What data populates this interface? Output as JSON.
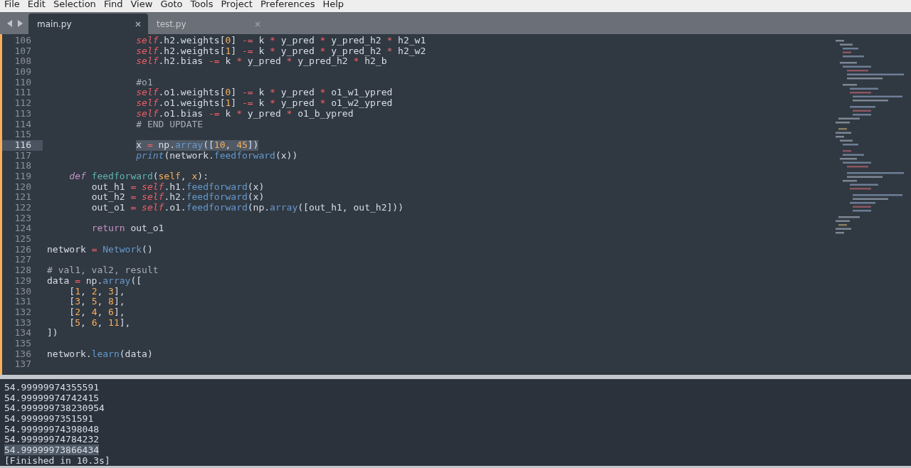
{
  "menu": [
    "File",
    "Edit",
    "Selection",
    "Find",
    "View",
    "Goto",
    "Tools",
    "Project",
    "Preferences",
    "Help"
  ],
  "tabs": [
    {
      "label": "main.py",
      "selected": true
    },
    {
      "label": "test.py",
      "selected": false
    }
  ],
  "editor": {
    "lines": [
      {
        "number": "106",
        "current": false,
        "selected": false,
        "tokens": [
          {
            "text": "                self",
            "kind": "self"
          },
          {
            "text": ".h2.weights[",
            "kind": "plain"
          },
          {
            "text": "0",
            "kind": "num"
          },
          {
            "text": "] ",
            "kind": "plain"
          },
          {
            "text": "-=",
            "kind": "op"
          },
          {
            "text": " k ",
            "kind": "plain"
          },
          {
            "text": "*",
            "kind": "op"
          },
          {
            "text": " y_pred ",
            "kind": "plain"
          },
          {
            "text": "*",
            "kind": "op"
          },
          {
            "text": " y_pred_h2 ",
            "kind": "plain"
          },
          {
            "text": "*",
            "kind": "op"
          },
          {
            "text": " h2_w1",
            "kind": "plain"
          }
        ]
      },
      {
        "number": "107",
        "current": false,
        "selected": false,
        "tokens": [
          {
            "text": "                self",
            "kind": "self"
          },
          {
            "text": ".h2.weights[",
            "kind": "plain"
          },
          {
            "text": "1",
            "kind": "num"
          },
          {
            "text": "] ",
            "kind": "plain"
          },
          {
            "text": "-=",
            "kind": "op"
          },
          {
            "text": " k ",
            "kind": "plain"
          },
          {
            "text": "*",
            "kind": "op"
          },
          {
            "text": " y_pred ",
            "kind": "plain"
          },
          {
            "text": "*",
            "kind": "op"
          },
          {
            "text": " y_pred_h2 ",
            "kind": "plain"
          },
          {
            "text": "*",
            "kind": "op"
          },
          {
            "text": " h2_w2",
            "kind": "plain"
          }
        ]
      },
      {
        "number": "108",
        "current": false,
        "selected": false,
        "tokens": [
          {
            "text": "                self",
            "kind": "self"
          },
          {
            "text": ".h2.bias ",
            "kind": "plain"
          },
          {
            "text": "-=",
            "kind": "op"
          },
          {
            "text": " k ",
            "kind": "plain"
          },
          {
            "text": "*",
            "kind": "op"
          },
          {
            "text": " y_pred ",
            "kind": "plain"
          },
          {
            "text": "*",
            "kind": "op"
          },
          {
            "text": " y_pred_h2 ",
            "kind": "plain"
          },
          {
            "text": "*",
            "kind": "op"
          },
          {
            "text": " h2_b",
            "kind": "plain"
          }
        ]
      },
      {
        "number": "109",
        "current": false,
        "selected": false
      },
      {
        "number": "110",
        "current": false,
        "selected": false,
        "tokens": [
          {
            "text": "                #o1",
            "kind": "comment"
          }
        ]
      },
      {
        "number": "111",
        "current": false,
        "selected": false,
        "tokens": [
          {
            "text": "                self",
            "kind": "self"
          },
          {
            "text": ".o1.weights[",
            "kind": "plain"
          },
          {
            "text": "0",
            "kind": "num"
          },
          {
            "text": "] ",
            "kind": "plain"
          },
          {
            "text": "-=",
            "kind": "op"
          },
          {
            "text": " k ",
            "kind": "plain"
          },
          {
            "text": "*",
            "kind": "op"
          },
          {
            "text": " y_pred ",
            "kind": "plain"
          },
          {
            "text": "*",
            "kind": "op"
          },
          {
            "text": " o1_w1_ypred",
            "kind": "plain"
          }
        ]
      },
      {
        "number": "112",
        "current": false,
        "selected": false,
        "tokens": [
          {
            "text": "                self",
            "kind": "self"
          },
          {
            "text": ".o1.weights[",
            "kind": "plain"
          },
          {
            "text": "1",
            "kind": "num"
          },
          {
            "text": "] ",
            "kind": "plain"
          },
          {
            "text": "-=",
            "kind": "op"
          },
          {
            "text": " k ",
            "kind": "plain"
          },
          {
            "text": "*",
            "kind": "op"
          },
          {
            "text": " y_pred ",
            "kind": "plain"
          },
          {
            "text": "*",
            "kind": "op"
          },
          {
            "text": " o1_w2_ypred",
            "kind": "plain"
          }
        ]
      },
      {
        "number": "113",
        "current": false,
        "selected": false,
        "tokens": [
          {
            "text": "                self",
            "kind": "self"
          },
          {
            "text": ".o1.bias ",
            "kind": "plain"
          },
          {
            "text": "-=",
            "kind": "op"
          },
          {
            "text": " k ",
            "kind": "plain"
          },
          {
            "text": "*",
            "kind": "op"
          },
          {
            "text": " y_pred ",
            "kind": "plain"
          },
          {
            "text": "*",
            "kind": "op"
          },
          {
            "text": " o1_b_ypred",
            "kind": "plain"
          }
        ]
      },
      {
        "number": "114",
        "current": false,
        "selected": false,
        "tokens": [
          {
            "text": "                # END UPDATE",
            "kind": "comment"
          }
        ]
      },
      {
        "number": "115",
        "current": false,
        "selected": false
      },
      {
        "number": "116",
        "current": true,
        "selected": true,
        "tokens": [
          {
            "text": "                x ",
            "kind": "plain"
          },
          {
            "text": "=",
            "kind": "op"
          },
          {
            "text": " np.",
            "kind": "plain"
          },
          {
            "text": "array",
            "kind": "func"
          },
          {
            "text": "([",
            "kind": "plain"
          },
          {
            "text": "10",
            "kind": "num"
          },
          {
            "text": ", ",
            "kind": "plain"
          },
          {
            "text": "45",
            "kind": "num"
          },
          {
            "text": "])",
            "kind": "plain"
          }
        ]
      },
      {
        "number": "117",
        "current": false,
        "selected": false,
        "tokens": [
          {
            "text": "                print",
            "kind": "builtin"
          },
          {
            "text": "(network.",
            "kind": "plain"
          },
          {
            "text": "feedforward",
            "kind": "func"
          },
          {
            "text": "(x))",
            "kind": "plain"
          }
        ]
      },
      {
        "number": "118",
        "current": false,
        "selected": false
      },
      {
        "number": "119",
        "current": false,
        "selected": false,
        "tokens": [
          {
            "text": "    def ",
            "kind": "defkw"
          },
          {
            "text": "feedforward",
            "kind": "defname"
          },
          {
            "text": "(",
            "kind": "plain"
          },
          {
            "text": "self",
            "kind": "param"
          },
          {
            "text": ", ",
            "kind": "plain"
          },
          {
            "text": "x",
            "kind": "param"
          },
          {
            "text": "):",
            "kind": "plain"
          }
        ]
      },
      {
        "number": "120",
        "current": false,
        "selected": false,
        "tokens": [
          {
            "text": "        out_h1 ",
            "kind": "plain"
          },
          {
            "text": "= ",
            "kind": "op"
          },
          {
            "text": "self",
            "kind": "self"
          },
          {
            "text": ".h1.",
            "kind": "plain"
          },
          {
            "text": "feedforward",
            "kind": "func"
          },
          {
            "text": "(x)",
            "kind": "plain"
          }
        ]
      },
      {
        "number": "121",
        "current": false,
        "selected": false,
        "tokens": [
          {
            "text": "        out_h2 ",
            "kind": "plain"
          },
          {
            "text": "= ",
            "kind": "op"
          },
          {
            "text": "self",
            "kind": "self"
          },
          {
            "text": ".h2.",
            "kind": "plain"
          },
          {
            "text": "feedforward",
            "kind": "func"
          },
          {
            "text": "(x)",
            "kind": "plain"
          }
        ]
      },
      {
        "number": "122",
        "current": false,
        "selected": false,
        "tokens": [
          {
            "text": "        out_o1 ",
            "kind": "plain"
          },
          {
            "text": "= ",
            "kind": "op"
          },
          {
            "text": "self",
            "kind": "self"
          },
          {
            "text": ".o1.",
            "kind": "plain"
          },
          {
            "text": "feedforward",
            "kind": "func"
          },
          {
            "text": "(np.",
            "kind": "plain"
          },
          {
            "text": "array",
            "kind": "func"
          },
          {
            "text": "([out_h1, out_h2]))",
            "kind": "plain"
          }
        ]
      },
      {
        "number": "123",
        "current": false,
        "selected": false
      },
      {
        "number": "124",
        "current": false,
        "selected": false,
        "tokens": [
          {
            "text": "        return",
            "kind": "keyword"
          },
          {
            "text": " out_o1",
            "kind": "plain"
          }
        ]
      },
      {
        "number": "125",
        "current": false,
        "selected": false
      },
      {
        "number": "126",
        "current": false,
        "selected": false,
        "tokens": [
          {
            "text": "network ",
            "kind": "plain"
          },
          {
            "text": "= ",
            "kind": "op"
          },
          {
            "text": "Network",
            "kind": "func"
          },
          {
            "text": "()",
            "kind": "plain"
          }
        ]
      },
      {
        "number": "127",
        "current": false,
        "selected": false
      },
      {
        "number": "128",
        "current": false,
        "selected": false,
        "tokens": [
          {
            "text": "# val1, val2, result",
            "kind": "comment"
          }
        ]
      },
      {
        "number": "129",
        "current": false,
        "selected": false,
        "tokens": [
          {
            "text": "data ",
            "kind": "plain"
          },
          {
            "text": "=",
            "kind": "op"
          },
          {
            "text": " np.",
            "kind": "plain"
          },
          {
            "text": "array",
            "kind": "func"
          },
          {
            "text": "([",
            "kind": "plain"
          }
        ]
      },
      {
        "number": "130",
        "current": false,
        "selected": false,
        "tokens": [
          {
            "text": "    [",
            "kind": "plain"
          },
          {
            "text": "1",
            "kind": "num"
          },
          {
            "text": ", ",
            "kind": "plain"
          },
          {
            "text": "2",
            "kind": "num"
          },
          {
            "text": ", ",
            "kind": "plain"
          },
          {
            "text": "3",
            "kind": "num"
          },
          {
            "text": "],",
            "kind": "plain"
          }
        ]
      },
      {
        "number": "131",
        "current": false,
        "selected": false,
        "tokens": [
          {
            "text": "    [",
            "kind": "plain"
          },
          {
            "text": "3",
            "kind": "num"
          },
          {
            "text": ", ",
            "kind": "plain"
          },
          {
            "text": "5",
            "kind": "num"
          },
          {
            "text": ", ",
            "kind": "plain"
          },
          {
            "text": "8",
            "kind": "num"
          },
          {
            "text": "],",
            "kind": "plain"
          }
        ]
      },
      {
        "number": "132",
        "current": false,
        "selected": false,
        "tokens": [
          {
            "text": "    [",
            "kind": "plain"
          },
          {
            "text": "2",
            "kind": "num"
          },
          {
            "text": ", ",
            "kind": "plain"
          },
          {
            "text": "4",
            "kind": "num"
          },
          {
            "text": ", ",
            "kind": "plain"
          },
          {
            "text": "6",
            "kind": "num"
          },
          {
            "text": "],",
            "kind": "plain"
          }
        ]
      },
      {
        "number": "133",
        "current": false,
        "selected": false,
        "tokens": [
          {
            "text": "    [",
            "kind": "plain"
          },
          {
            "text": "5",
            "kind": "num"
          },
          {
            "text": ", ",
            "kind": "plain"
          },
          {
            "text": "6",
            "kind": "num"
          },
          {
            "text": ", ",
            "kind": "plain"
          },
          {
            "text": "11",
            "kind": "num"
          },
          {
            "text": "],",
            "kind": "plain"
          }
        ]
      },
      {
        "number": "134",
        "current": false,
        "selected": false,
        "tokens": [
          {
            "text": "])",
            "kind": "plain"
          }
        ]
      },
      {
        "number": "135",
        "current": false,
        "selected": false
      },
      {
        "number": "136",
        "current": false,
        "selected": false,
        "tokens": [
          {
            "text": "network.",
            "kind": "plain"
          },
          {
            "text": "learn",
            "kind": "func"
          },
          {
            "text": "(data)",
            "kind": "plain"
          }
        ]
      },
      {
        "number": "137",
        "current": false,
        "selected": false
      }
    ]
  },
  "output": {
    "lines": [
      {
        "text": "54.99999974355591",
        "selected": false
      },
      {
        "text": "54.99999974742415",
        "selected": false
      },
      {
        "text": "54.999999738230954",
        "selected": false
      },
      {
        "text": "54.9999997351591",
        "selected": false
      },
      {
        "text": "54.99999974398048",
        "selected": false
      },
      {
        "text": "54.99999974784232",
        "selected": false
      },
      {
        "text": "54.99999973866434",
        "selected": true
      },
      {
        "text": "[Finished in 10.3s]",
        "selected": false
      }
    ]
  }
}
